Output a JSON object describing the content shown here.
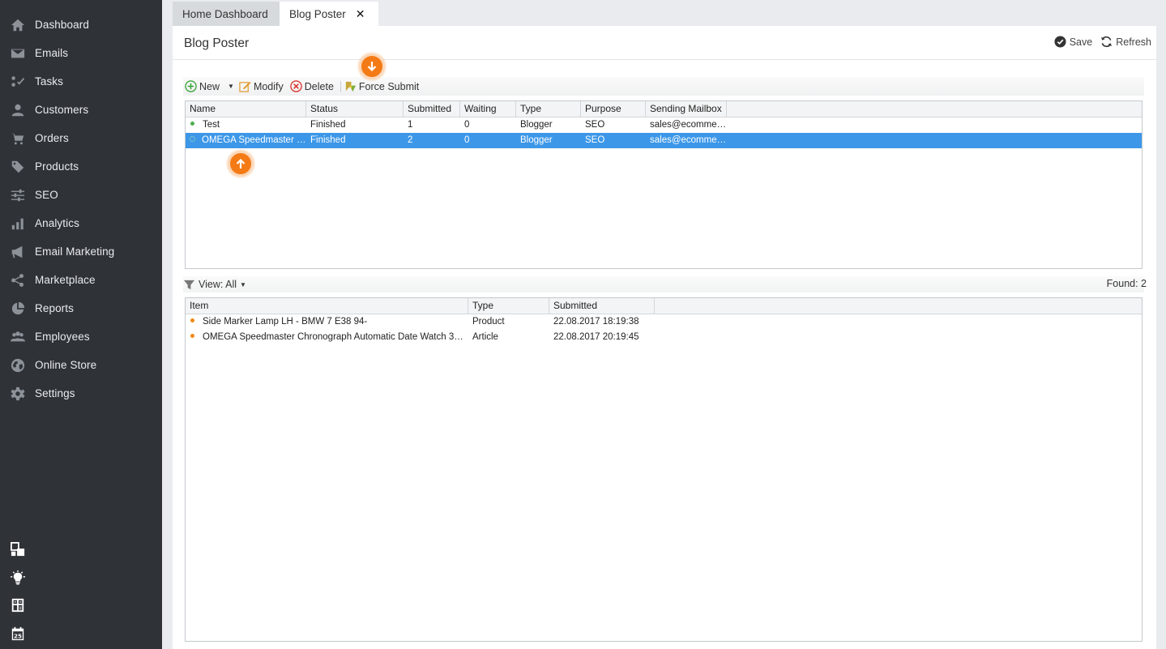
{
  "sidebar": {
    "items": [
      {
        "label": "Dashboard",
        "icon": "home-icon"
      },
      {
        "label": "Emails",
        "icon": "envelope-icon"
      },
      {
        "label": "Tasks",
        "icon": "tasks-icon"
      },
      {
        "label": "Customers",
        "icon": "user-icon"
      },
      {
        "label": "Orders",
        "icon": "cart-icon"
      },
      {
        "label": "Products",
        "icon": "tag-icon"
      },
      {
        "label": "SEO",
        "icon": "sliders-icon"
      },
      {
        "label": "Analytics",
        "icon": "bar-chart-icon"
      },
      {
        "label": "Email Marketing",
        "icon": "megaphone-icon"
      },
      {
        "label": "Marketplace",
        "icon": "share-icon"
      },
      {
        "label": "Reports",
        "icon": "pie-chart-icon"
      },
      {
        "label": "Employees",
        "icon": "group-icon"
      },
      {
        "label": "Online Store",
        "icon": "globe-icon"
      },
      {
        "label": "Settings",
        "icon": "gear-icon"
      }
    ],
    "bottom_icons": [
      "windows-icon",
      "lightbulb-icon",
      "calculator-icon",
      "calendar-icon"
    ],
    "calendar_day": "25"
  },
  "tabs": [
    {
      "label": "Home Dashboard"
    },
    {
      "label": "Blog Poster"
    }
  ],
  "panel": {
    "title": "Blog Poster",
    "save_label": "Save",
    "refresh_label": "Refresh"
  },
  "toolbar": {
    "new_label": "New",
    "modify_label": "Modify",
    "delete_label": "Delete",
    "force_submit_label": "Force Submit"
  },
  "top_grid": {
    "columns": [
      "Name",
      "Status",
      "Submitted",
      "Waiting",
      "Type",
      "Purpose",
      "Sending Mailbox"
    ],
    "rows": [
      {
        "name": "Test",
        "status": "Finished",
        "submitted": "1",
        "waiting": "0",
        "type": "Blogger",
        "purpose": "SEO",
        "mailbox": "sales@ecommer..."
      },
      {
        "name": "OMEGA Speedmaster C...",
        "status": "Finished",
        "submitted": "2",
        "waiting": "0",
        "type": "Blogger",
        "purpose": "SEO",
        "mailbox": "sales@ecommer..."
      }
    ]
  },
  "viewbar": {
    "view_label": "View: All",
    "found_label": "Found: 2"
  },
  "bottom_grid": {
    "columns": [
      "Item",
      "Type",
      "Submitted"
    ],
    "rows": [
      {
        "item": "Side Marker Lamp LH - BMW 7 E38 94-",
        "type": "Product",
        "submitted": "22.08.2017 18:19:38"
      },
      {
        "item": "OMEGA Speedmaster Chronograph Automatic Date Watch 351...",
        "type": "Article",
        "submitted": "22.08.2017 20:19:45"
      }
    ]
  },
  "colors": {
    "sidebar_bg": "#2f3338",
    "selection": "#3c97e8",
    "callout": "#f47a15"
  }
}
